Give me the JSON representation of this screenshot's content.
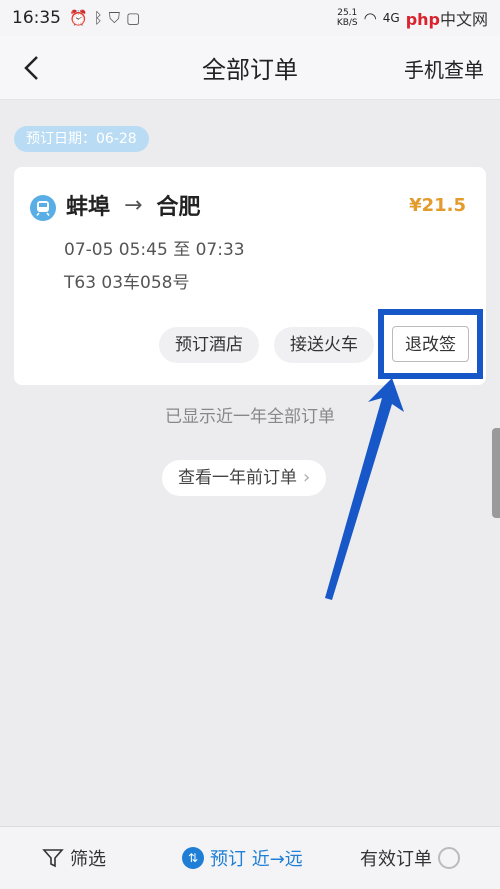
{
  "status": {
    "time": "16:35",
    "net_speed": "25.1",
    "net_unit": "KB/S",
    "signal_label": "4G",
    "brand": "php",
    "brand_suffix": "中文网"
  },
  "nav": {
    "title": "全部订单",
    "action": "手机查单"
  },
  "order_group": {
    "date_label": "预订日期：06-28"
  },
  "order": {
    "from": "蚌埠",
    "arrow": "→",
    "to": "合肥",
    "price": "¥21.5",
    "times": "07-05 05:45 至 07:33",
    "seat": "T63 03车058号",
    "actions": {
      "hotel": "预订酒店",
      "pickup": "接送火车",
      "refund": "退改签"
    }
  },
  "notice": "已显示近一年全部订单",
  "older_button": "查看一年前订单",
  "bottom": {
    "filter": "筛选",
    "sort_icon": "⇅",
    "sort": "预订 近→远",
    "valid": "有效订单"
  },
  "colors": {
    "accent": "#1f7fd6",
    "price": "#e39b2c",
    "highlight": "#1757c7"
  }
}
